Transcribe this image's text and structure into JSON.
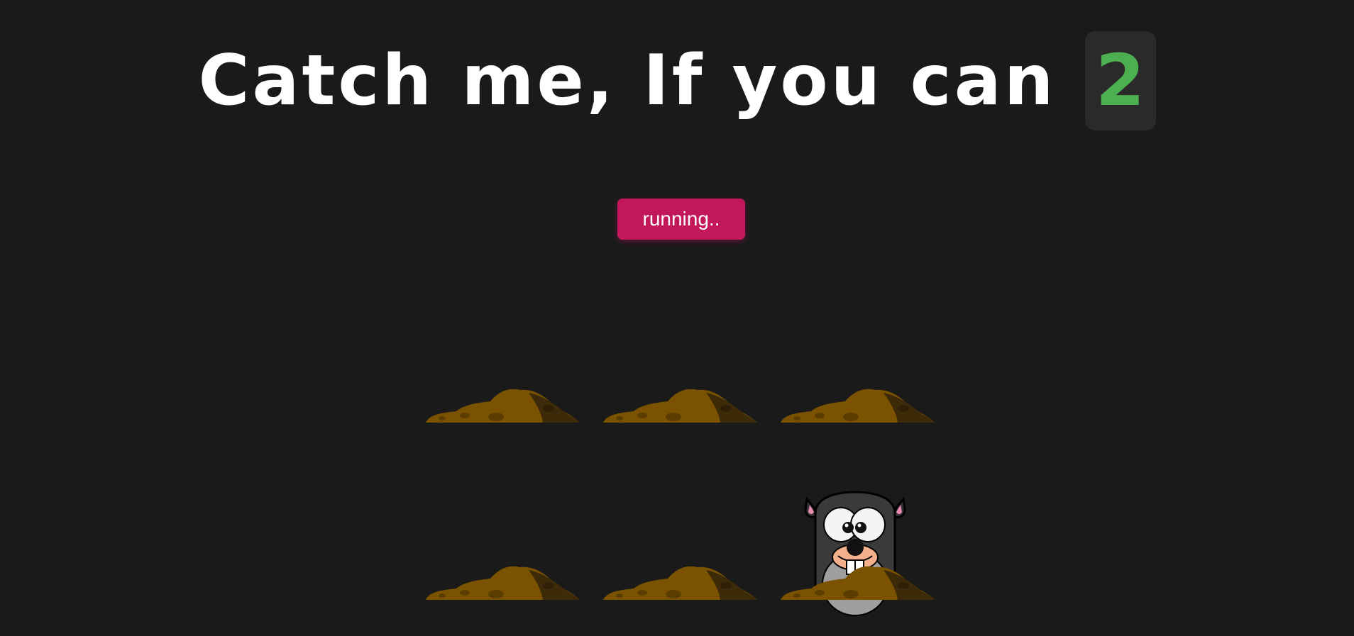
{
  "header": {
    "title": "Catch me, If you can",
    "score": "2"
  },
  "controls": {
    "status_label": "running.."
  },
  "board": {
    "rows": 2,
    "columns": 3,
    "holes": [
      {
        "id": "hole-1",
        "has_mole": false
      },
      {
        "id": "hole-2",
        "has_mole": false
      },
      {
        "id": "hole-3",
        "has_mole": false
      },
      {
        "id": "hole-4",
        "has_mole": false
      },
      {
        "id": "hole-5",
        "has_mole": false
      },
      {
        "id": "hole-6",
        "has_mole": true
      }
    ]
  },
  "colors": {
    "background": "#1a1a1a",
    "score": "#4caf50",
    "score_box": "#2a2a2a",
    "button": "#c2185b",
    "dirt": "#7a5200"
  },
  "icons": {
    "dirt": "dirt-mound-icon",
    "mole": "mole-icon"
  }
}
